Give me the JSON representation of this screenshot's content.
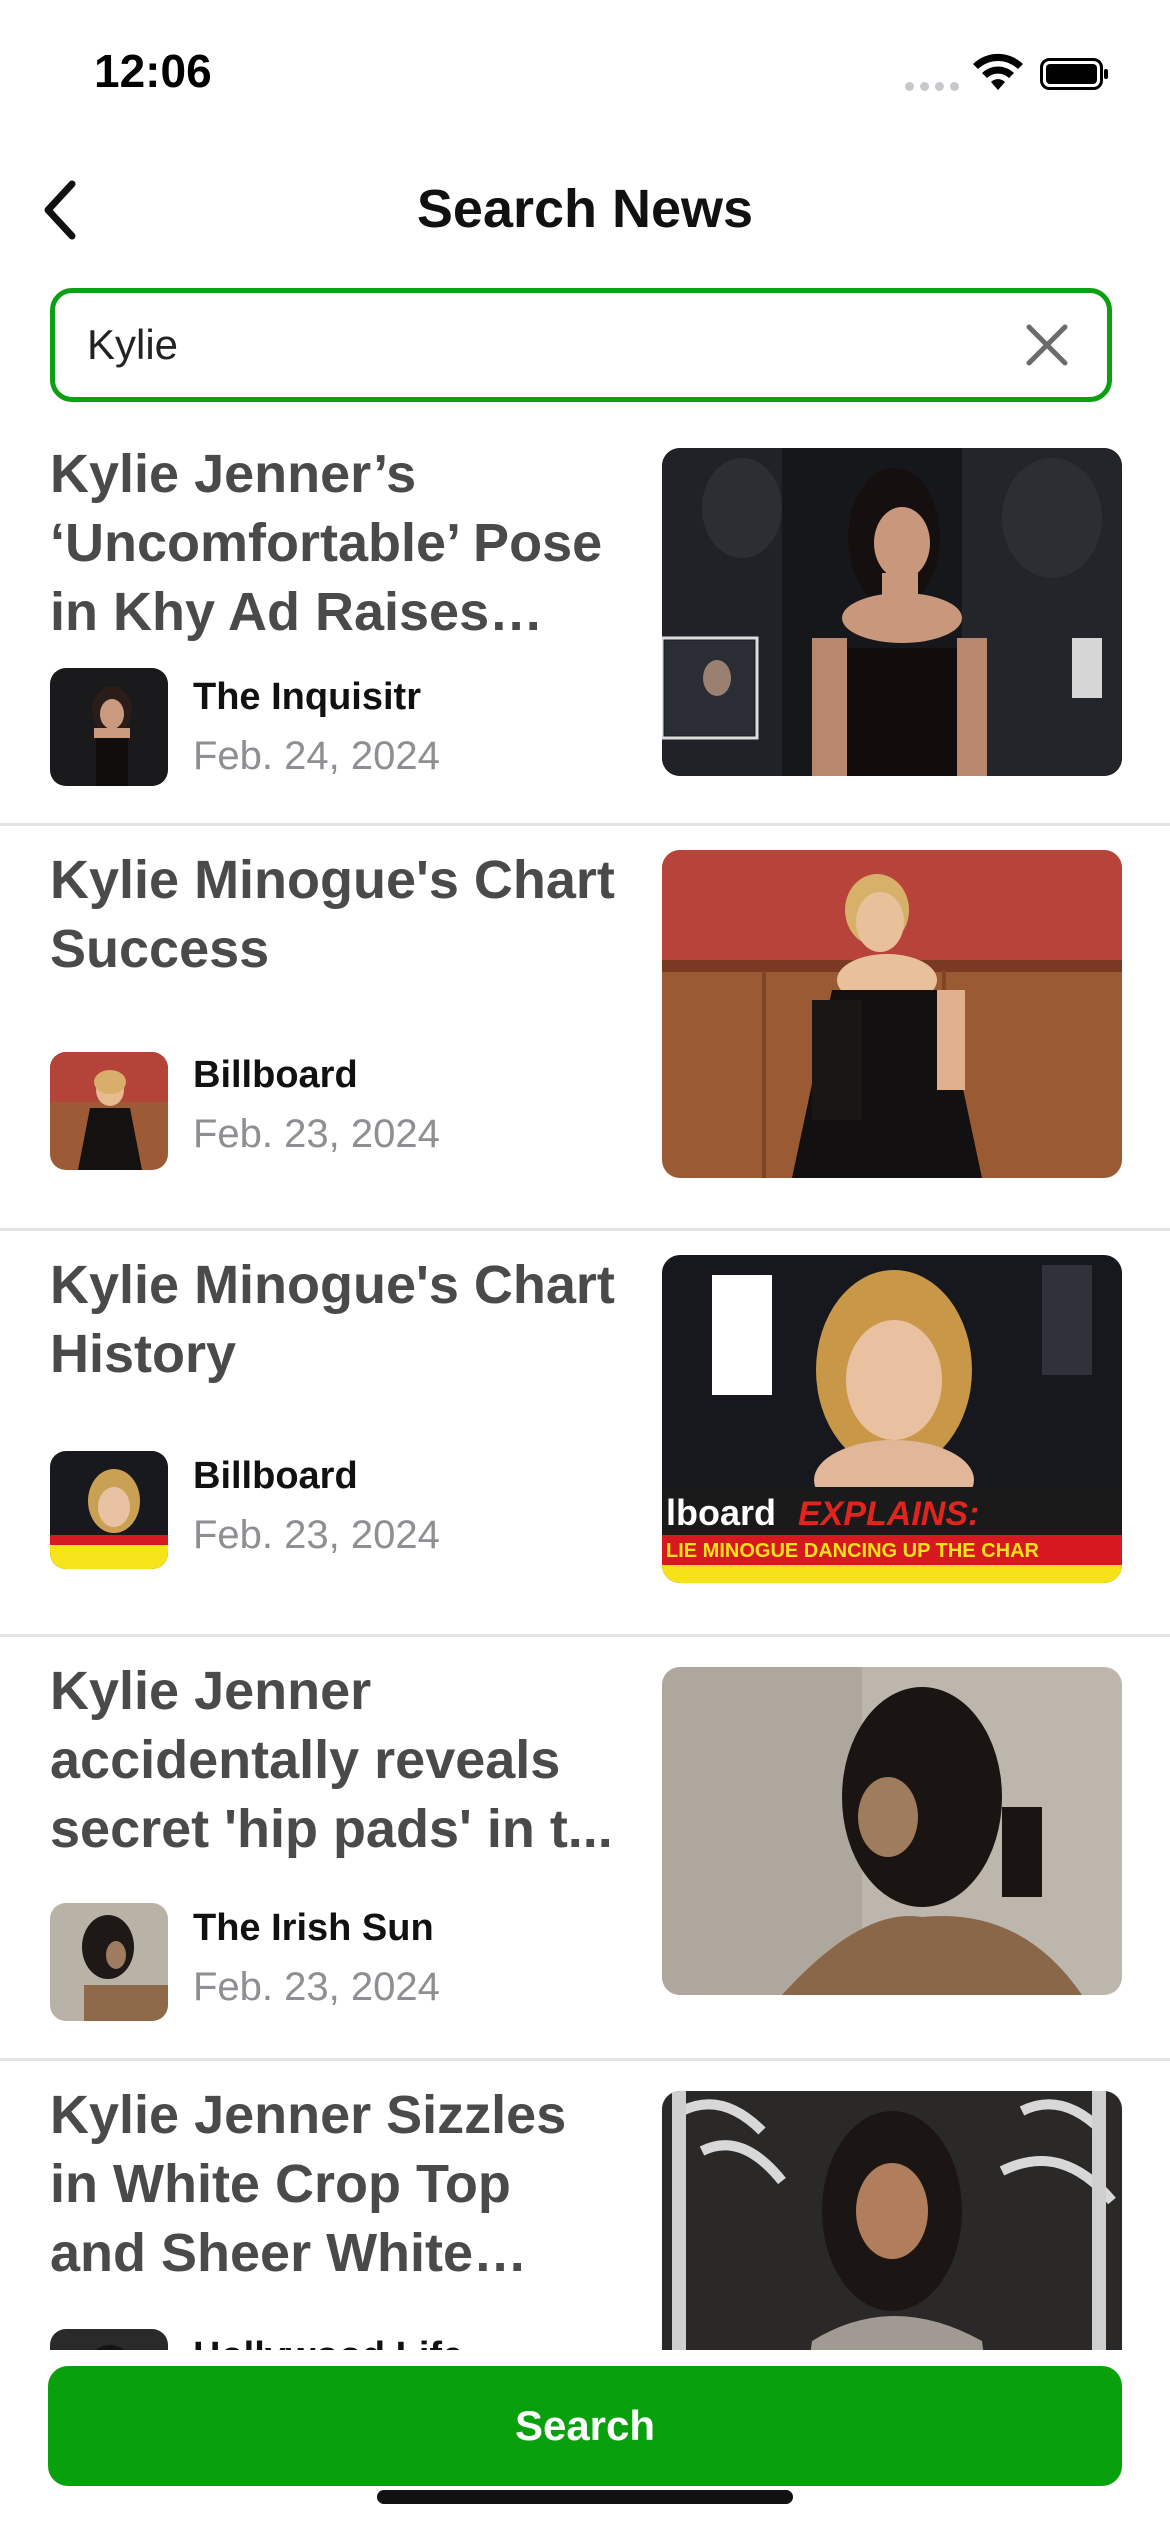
{
  "status_bar": {
    "time": "12:06"
  },
  "nav": {
    "title": "Search News"
  },
  "search": {
    "value": "Kylie",
    "placeholder": ""
  },
  "articles": [
    {
      "title": "Kylie Jenner’s ‘Uncomfortable’ Pose in Khy Ad Raises Co...",
      "source": "The Inquisitr",
      "date": "Feb. 24, 2024"
    },
    {
      "title": "Kylie Minogue's Chart Success",
      "source": "Billboard",
      "date": "Feb. 23, 2024"
    },
    {
      "title": "Kylie Minogue's Chart History",
      "source": "Billboard",
      "date": "Feb. 23, 2024",
      "image_text_1": "lboard",
      "image_text_2": "EXPLAINS:",
      "image_text_3": "LIE MINOGUE DANCING UP THE CHAR"
    },
    {
      "title": "Kylie Jenner accidentally reveals secret 'hip pads' in t...",
      "source": "The Irish Sun",
      "date": "Feb. 23, 2024"
    },
    {
      "title": "Kylie Jenner Sizzles in White Crop Top and Sheer White Skirt: V...",
      "source": "Hollywood Life",
      "date": ""
    }
  ],
  "bottom": {
    "search_label": "Search"
  },
  "colors": {
    "accent": "#08a00d",
    "title_text": "#4a4a4a",
    "date_text": "#8e8e93",
    "divider": "#e3e3e6"
  },
  "icons": {
    "back": "chevron-left-icon",
    "clear": "close-icon"
  }
}
